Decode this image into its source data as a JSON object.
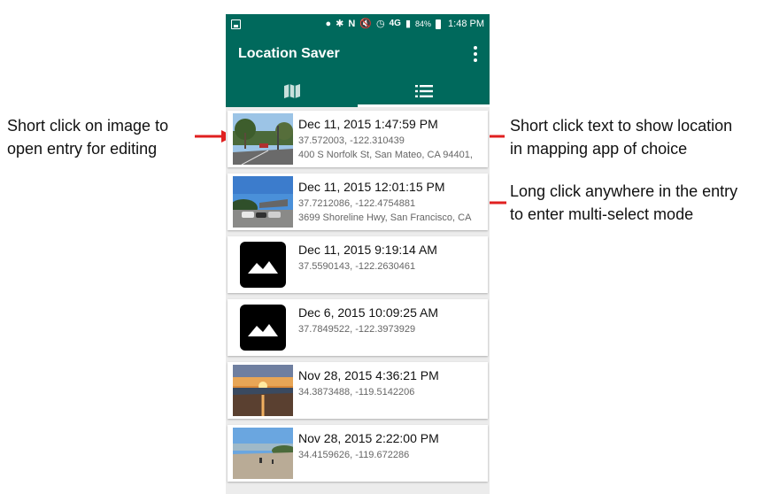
{
  "annotations": {
    "left": [
      "Short click on image to",
      "open entry for editing"
    ],
    "right_top": [
      "Short click text to show location",
      "in mapping app of choice"
    ],
    "right_bottom": [
      "Long click anywhere in the entry",
      "to enter multi-select mode"
    ]
  },
  "statusbar": {
    "battery": "84%",
    "time": "1:48 PM",
    "network": "4G"
  },
  "appbar": {
    "title": "Location Saver"
  },
  "tabs": [
    {
      "icon": "map-icon",
      "active": false
    },
    {
      "icon": "list-icon",
      "active": true
    }
  ],
  "entries": [
    {
      "date": "Dec 11, 2015 1:47:59 PM",
      "coords": "37.572003, -122.310439",
      "address": "400 S Norfolk St, San Mateo, CA 94401,",
      "thumb": "street-photo"
    },
    {
      "date": "Dec 11, 2015 12:01:15 PM",
      "coords": "37.7212086, -122.4754881",
      "address": "3699 Shoreline Hwy, San Francisco, CA",
      "thumb": "parking-photo"
    },
    {
      "date": "Dec 11, 2015 9:19:14 AM",
      "coords": "37.5590143, -122.2630461",
      "address": "",
      "thumb": "image-placeholder-icon"
    },
    {
      "date": "Dec 6, 2015 10:09:25 AM",
      "coords": "37.7849522, -122.3973929",
      "address": "",
      "thumb": "image-placeholder-icon"
    },
    {
      "date": "Nov 28, 2015 4:36:21 PM",
      "coords": "34.3873488, -119.5142206",
      "address": "",
      "thumb": "sunset-beach-photo"
    },
    {
      "date": "Nov 28, 2015 2:22:00 PM",
      "coords": "34.4159626, -119.672286",
      "address": "",
      "thumb": "beach-photo"
    }
  ],
  "colors": {
    "primary": "#00695c",
    "arrow": "#e02020"
  }
}
